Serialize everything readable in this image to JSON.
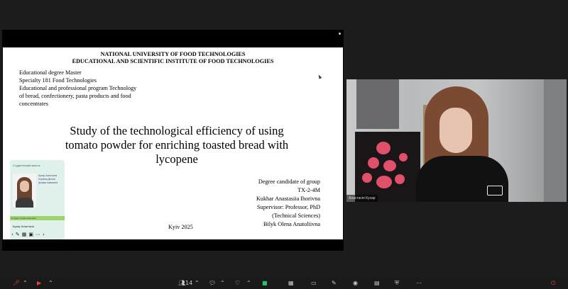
{
  "slide": {
    "university": "NATIONAL UNIVERSITY OF FOOD TECHNOLOGIES",
    "institute": "EDUCATIONAL AND SCIENTIFIC INSTITUTE OF FOOD TECHNOLOGIES",
    "meta": [
      "Educational degree Master",
      "Specialty 181 Food Technologies",
      "Educational and professional program Technology",
      "of bread, confectionery, pasta products and food",
      "concentrates"
    ],
    "title_lines": [
      "Study of the technological efficiency of using",
      "tomato powder for enriching toasted bread with",
      "lycopene"
    ],
    "candidate": [
      "Degree candidate of group",
      "TX-2-4M",
      "Kukhar Anastasiia Ihorivna",
      "Supervisor: Professor, PhD",
      "(Technical Sciences)",
      "Bilyk Olena Anatoliivna"
    ],
    "city_year": "Kyiv 2025"
  },
  "id_card": {
    "header": "Студентський квиток",
    "info": "Кухар Анастасія Ігорівна Денна форма навчання",
    "stripe": "Студент Кухар Анастасія",
    "name": "Кухар Анастасія"
  },
  "camera": {
    "name_tag": "Анастасія Кухар"
  },
  "toolbar": {
    "participants_count": "14"
  },
  "colors": {
    "mic_muted": "#e0493f",
    "share_active": "#27c26a",
    "background": "#1c1c1c"
  }
}
